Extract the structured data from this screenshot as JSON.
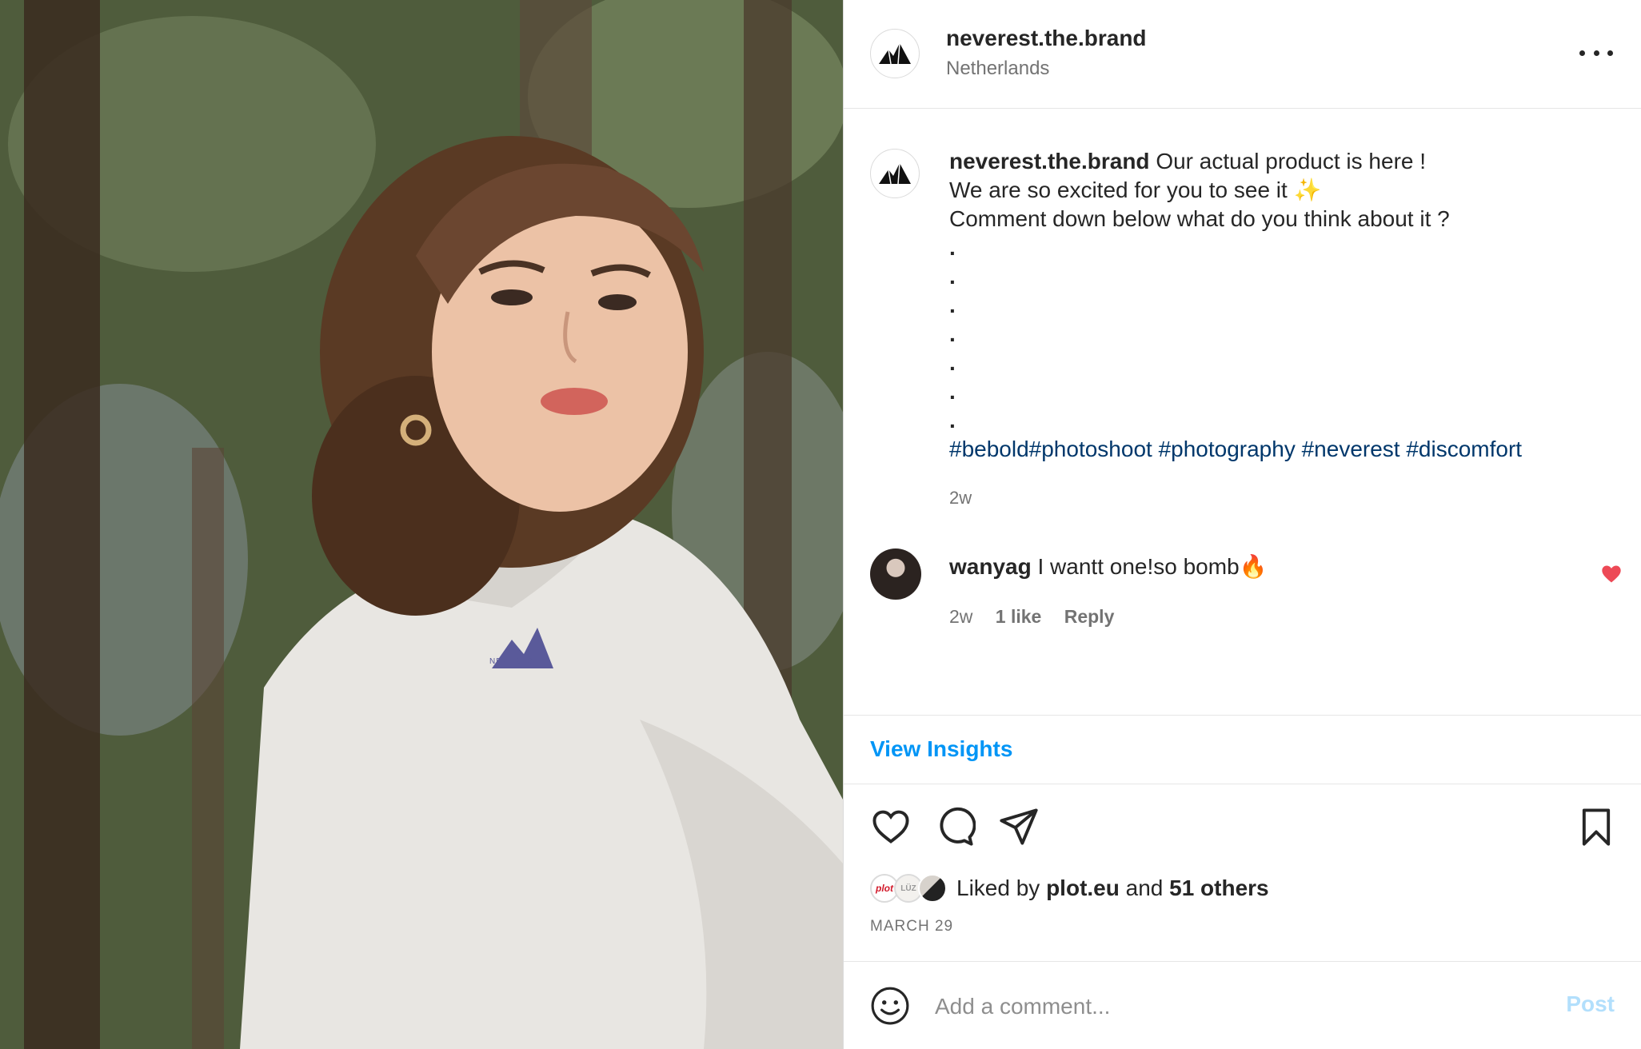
{
  "post": {
    "username": "neverest.the.brand",
    "location": "Netherlands",
    "caption_lines": [
      "Our actual product is here !",
      "We are so excited for you to see it ✨",
      "Comment down below what do you think about it ?"
    ],
    "dots": [
      ".",
      ".",
      ".",
      ".",
      ".",
      ".",
      "."
    ],
    "hashtags": "#bebold#photoshoot #photography #neverest #discomfort",
    "caption_time": "2w",
    "photo_logo_text": "NEVEREST"
  },
  "comment": {
    "username": "wanyag",
    "text": "I wantt one!so bomb🔥",
    "time": "2w",
    "likes": "1 like",
    "reply": "Reply"
  },
  "insights": {
    "label": "View Insights"
  },
  "likes": {
    "prefix": "Liked by",
    "user": "plot.eu",
    "conj": "and",
    "others": "51 others",
    "avatar1": "plot",
    "avatar2": "LÜZ"
  },
  "date": "MARCH 29",
  "add_comment": {
    "placeholder": "Add a comment...",
    "post_label": "Post"
  },
  "icons": {
    "more": "more-options-icon",
    "like": "heart-icon",
    "comment": "comment-icon",
    "share": "send-icon",
    "save": "bookmark-icon",
    "emoji": "emoji-icon",
    "comment_liked": "heart-filled-icon"
  },
  "colors": {
    "link": "#0095f6",
    "hashtag": "#00376b",
    "liked_heart": "#ed4956",
    "post_disabled": "#b2dffc"
  }
}
